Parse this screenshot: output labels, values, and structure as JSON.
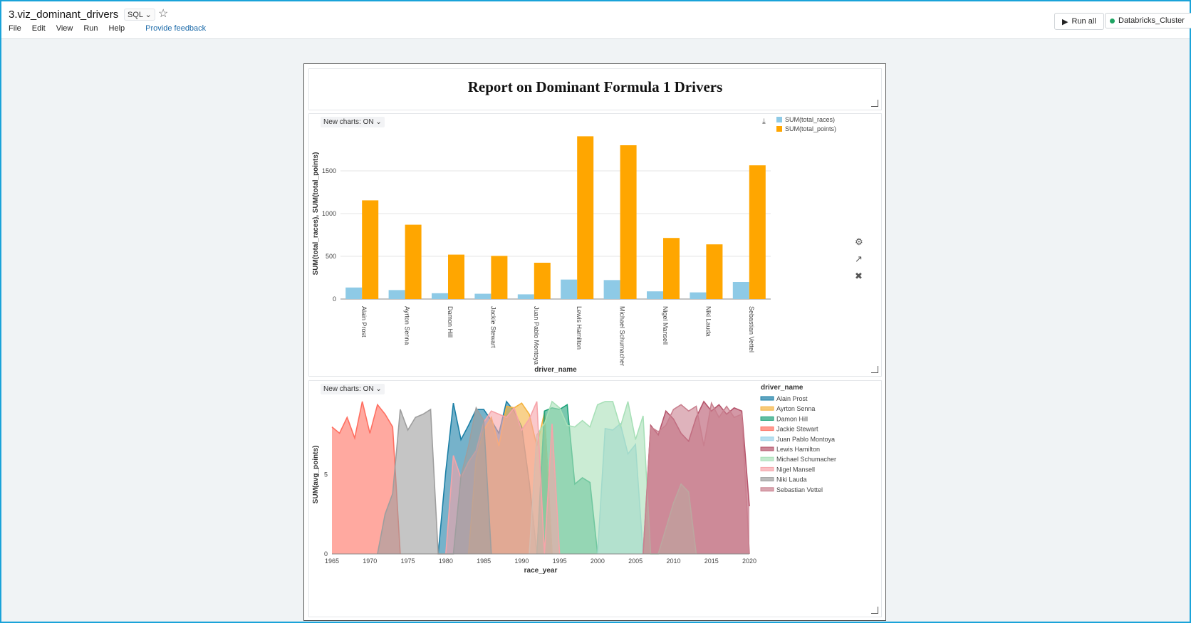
{
  "notebook": {
    "title": "3.viz_dominant_drivers",
    "language": "SQL",
    "menu": [
      "File",
      "Edit",
      "View",
      "Run",
      "Help"
    ],
    "feedback": "Provide feedback",
    "run_all": "Run all",
    "cluster": "Databricks_Cluster"
  },
  "dashboard": {
    "title": "Report on Dominant Formula 1 Drivers",
    "new_charts_label": "New charts: ON"
  },
  "chart_data": [
    {
      "type": "bar",
      "categories": [
        "Alain Prost",
        "Ayrton Senna",
        "Damon Hill",
        "Jackie Stewart",
        "Juan Pablo Montoya",
        "Lewis Hamilton",
        "Michael Schumacher",
        "Nigel Mansell",
        "Niki Lauda",
        "Sebastian Vettel"
      ],
      "series": [
        {
          "name": "SUM(total_races)",
          "color": "#8ecae6",
          "values": [
            135,
            105,
            68,
            62,
            55,
            228,
            222,
            90,
            78,
            200
          ]
        },
        {
          "name": "SUM(total_points)",
          "color": "#ffa600",
          "values": [
            1155,
            870,
            520,
            505,
            425,
            1905,
            1800,
            715,
            640,
            1565
          ]
        }
      ],
      "xlabel": "driver_name",
      "ylabel": "SUM(total_races), SUM(total_points)",
      "yticks": [
        0,
        500,
        1000,
        1500
      ],
      "ylim": [
        0,
        2000
      ],
      "grid": true,
      "legend": "top-right"
    },
    {
      "type": "area",
      "xlabel": "race_year",
      "ylabel": "SUM(avg_points)",
      "xticks": [
        1965,
        1970,
        1975,
        1980,
        1985,
        1990,
        1995,
        2000,
        2005,
        2010,
        2015,
        2020
      ],
      "yticks": [
        0,
        5
      ],
      "xlim": [
        1965,
        2020
      ],
      "ylim": [
        0,
        10
      ],
      "legend_title": "driver_name",
      "legend": "right",
      "series": [
        {
          "name": "Alain Prost",
          "color": "#1b7fa6",
          "x": [
            1979,
            1980,
            1981,
            1982,
            1983,
            1984,
            1985,
            1986,
            1987,
            1988,
            1989,
            1990,
            1991,
            1992,
            1993,
            1994
          ],
          "y": [
            0,
            5.2,
            9.5,
            7.2,
            8.1,
            9.1,
            9.1,
            8.4,
            7.6,
            9.6,
            9.0,
            8.0,
            4.5,
            0,
            9.0,
            0
          ]
        },
        {
          "name": "Ayrton Senna",
          "color": "#f4b340",
          "x": [
            1983,
            1984,
            1985,
            1986,
            1987,
            1988,
            1989,
            1990,
            1991,
            1992,
            1993,
            1994
          ],
          "y": [
            0,
            6.0,
            7.8,
            8.6,
            6.8,
            9.3,
            9.2,
            9.5,
            8.8,
            6.8,
            8.9,
            0
          ]
        },
        {
          "name": "Damon Hill",
          "color": "#1fa37a",
          "x": [
            1992,
            1993,
            1994,
            1995,
            1996,
            1997,
            1998,
            1999,
            2000
          ],
          "y": [
            0,
            9.0,
            9.2,
            9.1,
            9.4,
            4.4,
            4.8,
            4.5,
            0
          ]
        },
        {
          "name": "Jackie Stewart",
          "color": "#ff6f61",
          "x": [
            1965,
            1966,
            1967,
            1968,
            1969,
            1970,
            1971,
            1972,
            1973,
            1974
          ],
          "y": [
            8.0,
            7.6,
            8.6,
            7.3,
            9.6,
            7.6,
            9.4,
            8.8,
            8.0,
            0
          ]
        },
        {
          "name": "Juan Pablo Montoya",
          "color": "#9ad2e8",
          "x": [
            2000,
            2001,
            2002,
            2003,
            2004,
            2005,
            2006
          ],
          "y": [
            0,
            7.9,
            7.8,
            8.2,
            6.3,
            6.9,
            0
          ]
        },
        {
          "name": "Lewis Hamilton",
          "color": "#b5546b",
          "x": [
            2006,
            2007,
            2008,
            2009,
            2010,
            2011,
            2012,
            2013,
            2014,
            2015,
            2016,
            2017,
            2018,
            2019,
            2020
          ],
          "y": [
            0,
            8.1,
            7.5,
            9.0,
            8.5,
            7.6,
            7.1,
            8.6,
            9.6,
            9.0,
            9.4,
            8.8,
            9.2,
            9.0,
            3.0
          ]
        },
        {
          "name": "Michael Schumacher",
          "color": "#a8e0b8",
          "x": [
            1991,
            1992,
            1993,
            1994,
            1995,
            1996,
            1997,
            1998,
            1999,
            2000,
            2001,
            2002,
            2003,
            2004,
            2005,
            2006,
            2007,
            2008,
            2010,
            2011,
            2012,
            2013
          ],
          "y": [
            0,
            7.5,
            8.2,
            9.6,
            9.2,
            8.1,
            8.0,
            8.4,
            8.0,
            9.4,
            9.6,
            9.6,
            8.0,
            9.6,
            7.2,
            8.7,
            0,
            0,
            3.2,
            4.4,
            3.9,
            0
          ]
        },
        {
          "name": "Nigel Mansell",
          "color": "#f6a4a9",
          "x": [
            1980,
            1981,
            1982,
            1983,
            1984,
            1985,
            1986,
            1987,
            1988,
            1989,
            1990,
            1991,
            1992,
            1993,
            1994,
            1995
          ],
          "y": [
            0,
            6.2,
            4.8,
            5.8,
            6.5,
            8.3,
            9.0,
            8.8,
            8.6,
            9.2,
            7.8,
            8.5,
            9.6,
            0,
            8.2,
            0
          ]
        },
        {
          "name": "Niki Lauda",
          "color": "#9e9e9e",
          "x": [
            1971,
            1972,
            1973,
            1974,
            1975,
            1976,
            1977,
            1978,
            1979,
            1980,
            1981,
            1982,
            1983,
            1984,
            1985,
            1986
          ],
          "y": [
            0,
            2.5,
            3.8,
            9.1,
            7.8,
            8.6,
            8.8,
            9.1,
            0,
            0,
            0,
            4.9,
            6.8,
            9.2,
            8.4,
            0
          ]
        },
        {
          "name": "Sebastian Vettel",
          "color": "#c9808f",
          "x": [
            2006,
            2007,
            2008,
            2009,
            2010,
            2011,
            2012,
            2013,
            2014,
            2015,
            2016,
            2017,
            2018,
            2019,
            2020
          ],
          "y": [
            0,
            8.0,
            7.7,
            8.1,
            9.1,
            9.4,
            9.0,
            9.3,
            6.8,
            9.5,
            8.6,
            9.3,
            8.6,
            8.8,
            0
          ]
        }
      ]
    }
  ]
}
